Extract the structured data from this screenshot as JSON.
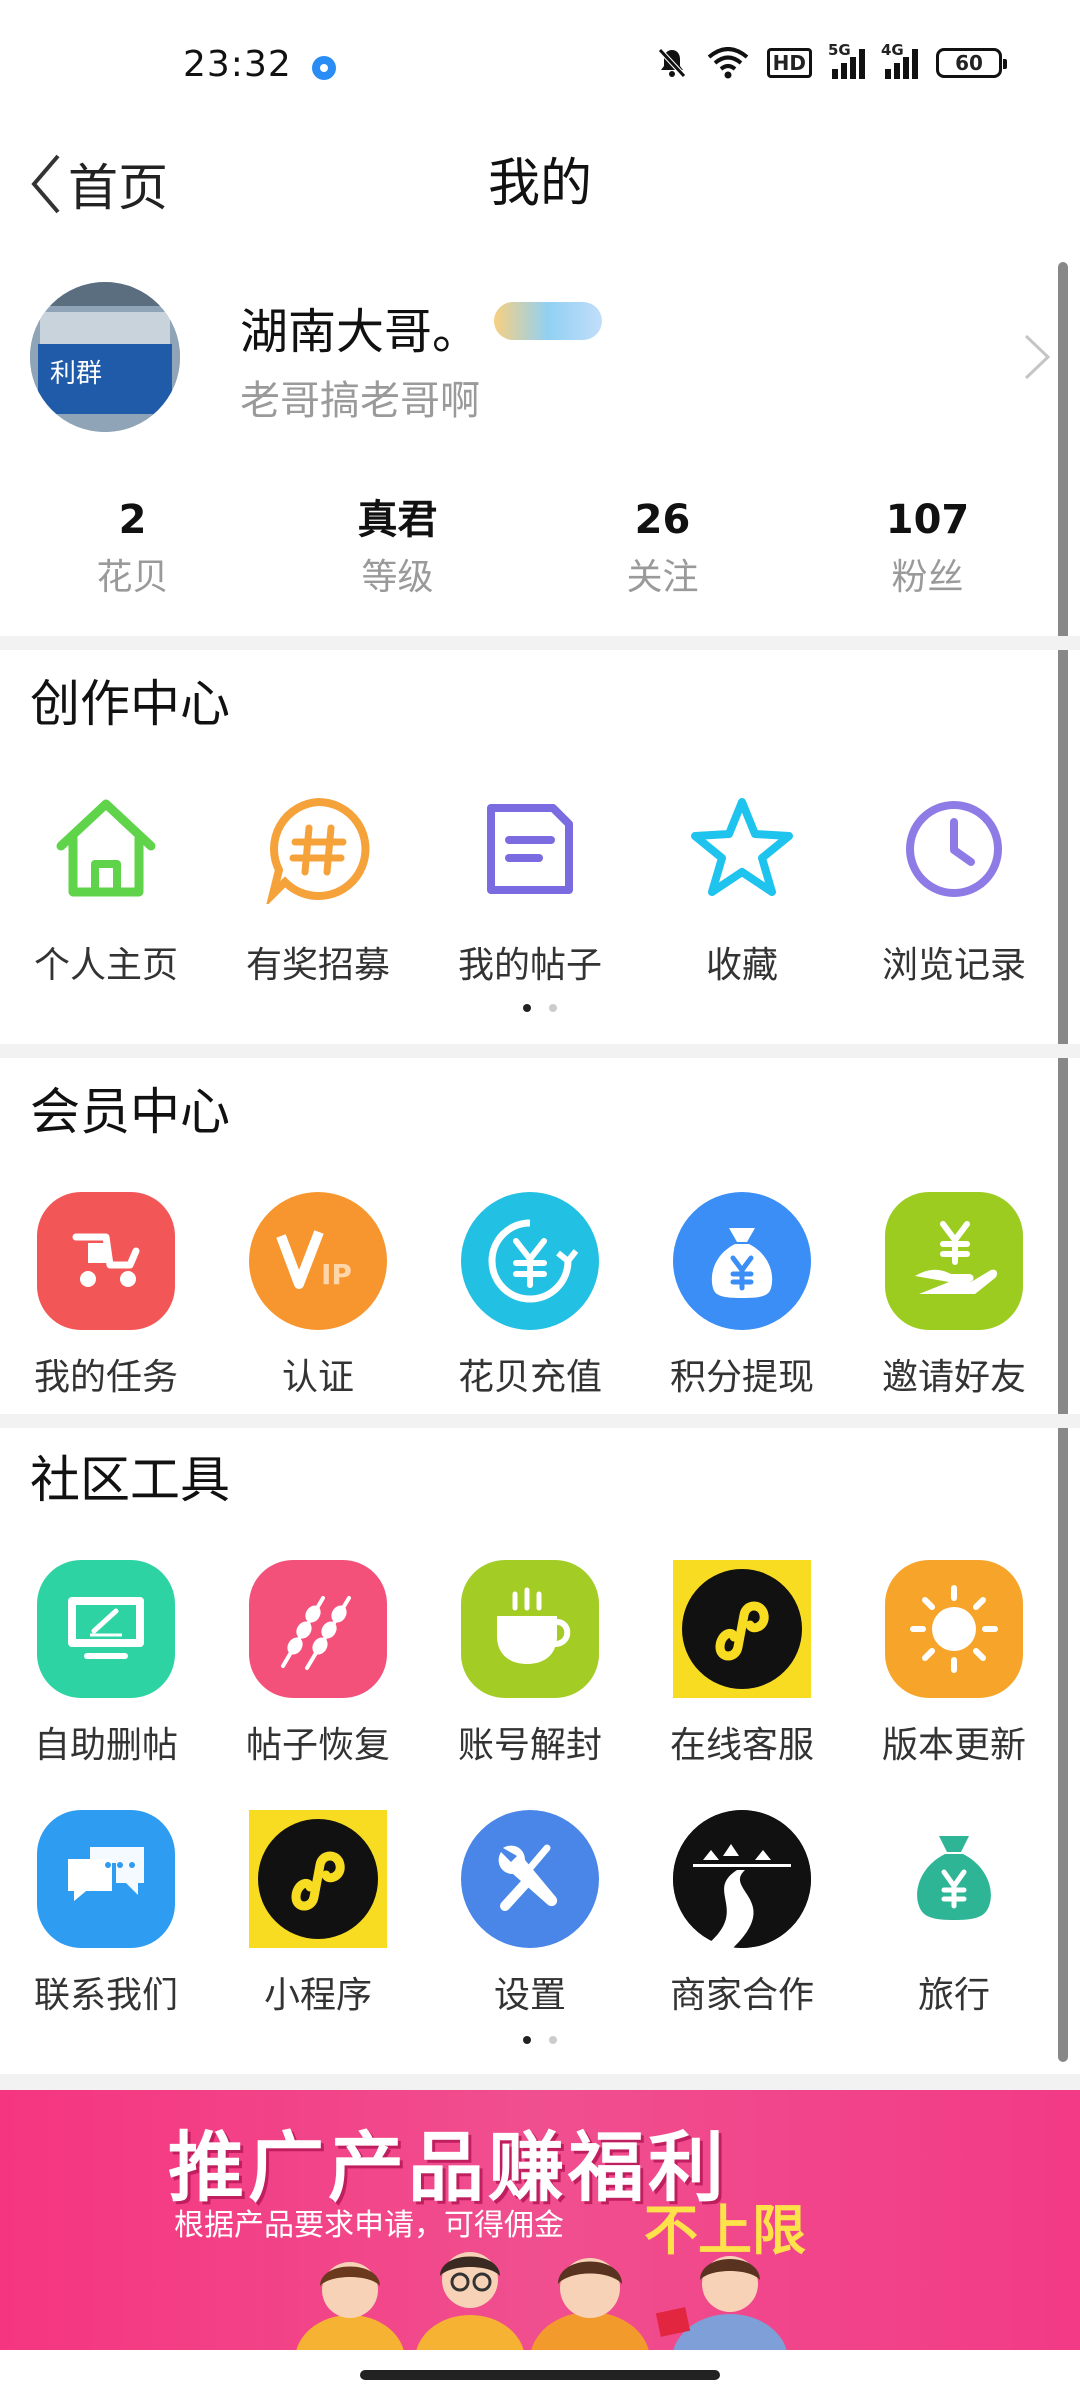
{
  "status_bar": {
    "time": "23:32",
    "hd_label": "HD",
    "signal1": "5G",
    "signal2": "4G",
    "battery": "60"
  },
  "nav": {
    "back_label": "首页",
    "title": "我的"
  },
  "profile": {
    "name": "湖南大哥。",
    "bio": "老哥搞老哥啊",
    "avatar_text": "利群"
  },
  "stats": [
    {
      "value": "2",
      "label": "花贝"
    },
    {
      "value": "真君",
      "label": "等级"
    },
    {
      "value": "26",
      "label": "关注"
    },
    {
      "value": "107",
      "label": "粉丝"
    }
  ],
  "creation": {
    "title": "创作中心",
    "items": [
      {
        "label": "个人主页",
        "icon": "home-icon"
      },
      {
        "label": "有奖招募",
        "icon": "hashtag-icon"
      },
      {
        "label": "我的帖子",
        "icon": "document-icon"
      },
      {
        "label": "收藏",
        "icon": "star-icon"
      },
      {
        "label": "浏览记录",
        "icon": "clock-icon"
      }
    ]
  },
  "member": {
    "title": "会员中心",
    "items": [
      {
        "label": "我的任务",
        "icon": "task-icon"
      },
      {
        "label": "认证",
        "icon": "vip-icon"
      },
      {
        "label": "花贝充值",
        "icon": "yuan-recharge-icon"
      },
      {
        "label": "积分提现",
        "icon": "money-bag-icon"
      },
      {
        "label": "邀请好友",
        "icon": "hand-yuan-icon"
      }
    ]
  },
  "tools": {
    "title": "社区工具",
    "row1": [
      {
        "label": "自助删帖",
        "icon": "monitor-pen-icon"
      },
      {
        "label": "帖子恢复",
        "icon": "skewers-icon"
      },
      {
        "label": "账号解封",
        "icon": "cup-icon"
      },
      {
        "label": "在线客服",
        "icon": "mini-program-icon"
      },
      {
        "label": "版本更新",
        "icon": "sun-icon"
      }
    ],
    "row2": [
      {
        "label": "联系我们",
        "icon": "chat-icon"
      },
      {
        "label": "小程序",
        "icon": "mini-program-icon"
      },
      {
        "label": "设置",
        "icon": "wrench-icon"
      },
      {
        "label": "商家合作",
        "icon": "mountain-road-icon"
      },
      {
        "label": "旅行",
        "icon": "yuan-bag-icon"
      }
    ]
  },
  "banner": {
    "title": "推广产品赚福利",
    "subtitle": "根据产品要求申请，可得佣金",
    "highlight": "不上限"
  },
  "colors": {
    "home_green": "#5fd34a",
    "hashtag_orange": "#f5a23a",
    "doc_purple": "#7a6be0",
    "star_cyan": "#1ec3ee",
    "clock_purple": "#8e7be6",
    "task_red": "#f25656",
    "vip_orange": "#f7962f",
    "recharge_cyan": "#22c0e3",
    "bag_blue": "#3b8ef5",
    "invite_green": "#9ccc1f",
    "monitor_green": "#2ed3a3",
    "skewer_pink": "#f4517a",
    "cup_green": "#a3cc24",
    "mini_yellow": "#f8dc22",
    "sun_orange": "#f6a52a",
    "chat_blue": "#2e9cf0",
    "wrench_blue": "#4a86e8",
    "travel_teal": "#2db596",
    "banner_pink": "#f04f8f"
  }
}
